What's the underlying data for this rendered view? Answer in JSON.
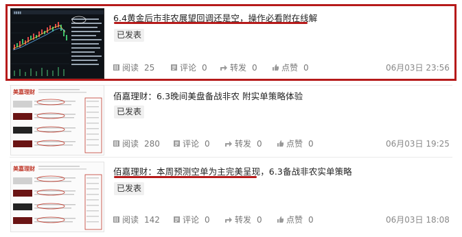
{
  "articles": [
    {
      "title": "6.4黄金后市非农展望回调还是空，操作必看附在线解",
      "status": "已发表",
      "read_label": "阅读",
      "read_count": "25",
      "comment_label": "评论",
      "comment_count": "0",
      "share_label": "转发",
      "share_count": "0",
      "like_label": "点赞",
      "like_count": "0",
      "date": "06月03日 23:56"
    },
    {
      "title": "佰嘉理财：6.3晚间美盘备战非农 附实单策略体验",
      "status": "已发表",
      "read_label": "阅读",
      "read_count": "280",
      "comment_label": "评论",
      "comment_count": "0",
      "share_label": "转发",
      "share_count": "0",
      "like_label": "点赞",
      "like_count": "0",
      "date": "06月03日 19:25"
    },
    {
      "title": "佰嘉理财：本周预测空单为主完美呈现，6.3备战非农实单策略",
      "status": "已发表",
      "read_label": "阅读",
      "read_count": "142",
      "comment_label": "评论",
      "comment_count": "0",
      "share_label": "转发",
      "share_count": "0",
      "like_label": "点赞",
      "like_count": "0",
      "date": "06月03日 18:08"
    }
  ],
  "colors": {
    "highlight_red": "#b61a1a",
    "stat_gray": "#777777",
    "badge_bg": "#f0f0f0"
  },
  "icons": [
    "read-icon",
    "comment-icon",
    "share-icon",
    "like-icon"
  ]
}
